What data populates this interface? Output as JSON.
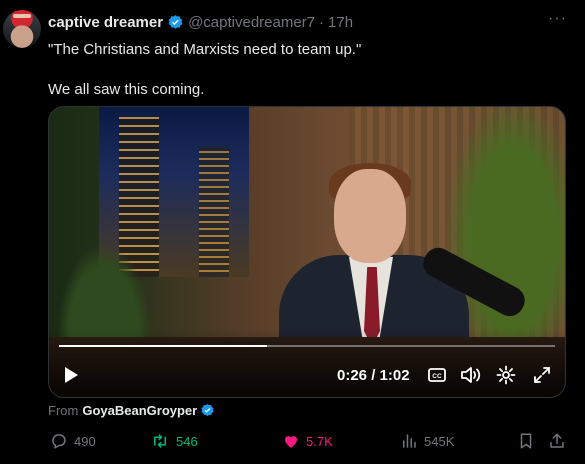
{
  "tweet": {
    "display_name": "captive dreamer",
    "handle": "@captivedreamer7",
    "separator": "·",
    "time": "17h",
    "more_icon": "more-dots-icon",
    "text_lines": [
      "\"The Christians and Marxists need to team up.\"",
      "We all saw this coming."
    ]
  },
  "video": {
    "progress": 0.42,
    "time_readout": "0:26 / 1:02",
    "controls": [
      "play-icon",
      "captions-icon",
      "volume-icon",
      "settings-icon",
      "fullscreen-icon"
    ]
  },
  "source": {
    "from_label": "From",
    "name": "GoyaBeanGroyper"
  },
  "actions": {
    "replies": "490",
    "reposts": "546",
    "likes": "5.7K",
    "views": "545K"
  },
  "colors": {
    "verified": "#1d9bf0",
    "repost": "#00ba7c",
    "like": "#f91880",
    "muted": "#71767b"
  }
}
